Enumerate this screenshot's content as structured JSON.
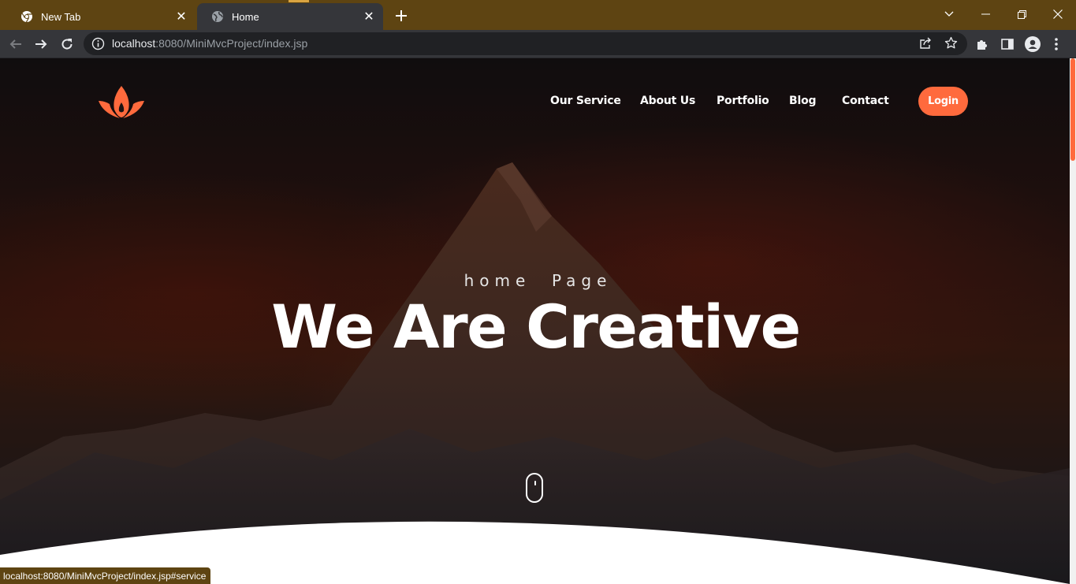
{
  "browser": {
    "tabs": [
      {
        "title": "New Tab",
        "icon": "chrome-icon",
        "active": false
      },
      {
        "title": "Home",
        "icon": "globe-icon",
        "active": true
      }
    ],
    "url_host": "localhost",
    "url_rest": ":8080/MiniMvcProject/index.jsp",
    "status_url": "localhost:8080/MiniMvcProject/index.jsp#service",
    "theme_color": "#5e4412"
  },
  "site": {
    "logo": "lotus-logo-icon",
    "nav": [
      "Our Service",
      "About Us",
      "Portfolio",
      "Blog",
      "Contact"
    ],
    "login_label": "Login",
    "hero_subtitle": "home  Page",
    "hero_title": "We Are Creative",
    "accent_color": "#ff6a3d"
  }
}
